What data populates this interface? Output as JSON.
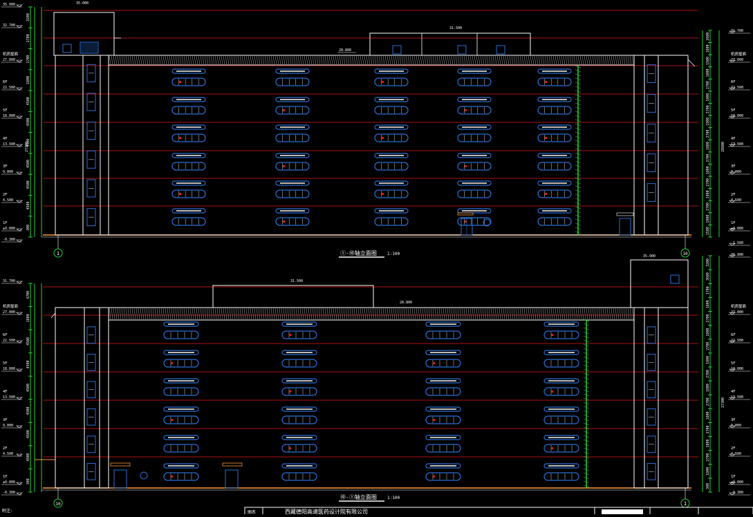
{
  "colors": {
    "background": "#000000",
    "outline": "#ffffff",
    "level_line": "#e81a1a",
    "dimension": "#29d23a",
    "window": "#2d6fd6",
    "facade": "#ff9a3c",
    "parapet_hatch": "#b0b0b0"
  },
  "top_elevation": {
    "title": "①-⑩轴立面图",
    "scale": "1:100",
    "axis_start": "1",
    "axis_end": "10",
    "tower_top_elev": "35.000",
    "roof_box_elev": "31.500",
    "parapet_elev": "28.800",
    "left_levels": [
      {
        "name": "",
        "elev": "35.900"
      },
      {
        "name": "",
        "elev": "32.700"
      },
      {
        "name": "机房屋面",
        "elev": "27.000"
      },
      {
        "name": "6F",
        "elev": "22.500"
      },
      {
        "name": "5F",
        "elev": "18.000"
      },
      {
        "name": "4F",
        "elev": "13.500"
      },
      {
        "name": "3F",
        "elev": "9.000"
      },
      {
        "name": "2F",
        "elev": "4.500"
      },
      {
        "name": "1F",
        "elev": "±0.000"
      },
      {
        "name": "",
        "elev": "-0.300"
      }
    ],
    "right_levels": [
      {
        "name": "",
        "elev": "31.700"
      },
      {
        "name": "机房屋面",
        "elev": "27.000"
      },
      {
        "name": "6F",
        "elev": "22.500"
      },
      {
        "name": "5F",
        "elev": "18.000"
      },
      {
        "name": "4F",
        "elev": "13.500"
      },
      {
        "name": "3F",
        "elev": "9.000"
      },
      {
        "name": "2F",
        "elev": "4.500"
      },
      {
        "name": "1F",
        "elev": "±0.000"
      },
      {
        "name": "",
        "elev": "-1.500"
      }
    ],
    "left_dims": [
      "3200",
      "2700",
      "1700",
      "1800",
      "4500",
      "4500",
      "4500",
      "4500",
      "4500",
      "4500",
      "300"
    ],
    "right_dims": [
      "2600",
      "1800",
      "1500",
      "1800",
      "2700",
      "1800",
      "2700",
      "1800",
      "2700",
      "1800",
      "2700",
      "1800",
      "2700",
      "1800",
      "2700",
      "1800",
      "1500"
    ],
    "right_total": "28800",
    "left_total": "27300"
  },
  "bottom_elevation": {
    "title": "⑩-①轴立面图",
    "scale": "1:100",
    "axis_start": "10",
    "axis_end": "1",
    "tower_top_elev": "35.900",
    "roof_box_elev": "31.500",
    "parapet_elev": "28.800",
    "left_levels": [
      {
        "name": "",
        "elev": "31.700"
      },
      {
        "name": "机房屋面",
        "elev": "27.000"
      },
      {
        "name": "6F",
        "elev": "22.500"
      },
      {
        "name": "5F",
        "elev": "18.000"
      },
      {
        "name": "4F",
        "elev": "13.500"
      },
      {
        "name": "3F",
        "elev": "9.000"
      },
      {
        "name": "2F",
        "elev": "4.500"
      },
      {
        "name": "1F",
        "elev": "±0.000"
      },
      {
        "name": "",
        "elev": "-0.300"
      }
    ],
    "right_levels": [
      {
        "name": "",
        "elev": "35.900"
      },
      {
        "name": "机房屋面",
        "elev": "27.000"
      },
      {
        "name": "6F",
        "elev": "22.500"
      },
      {
        "name": "5F",
        "elev": "18.000"
      },
      {
        "name": "4F",
        "elev": "13.500"
      },
      {
        "name": "3F",
        "elev": "9.000"
      },
      {
        "name": "2F",
        "elev": "4.500"
      },
      {
        "name": "1F",
        "elev": "±0.000"
      },
      {
        "name": "",
        "elev": "-0.300"
      }
    ],
    "left_dims": [
      "4700",
      "1800",
      "4500",
      "4500",
      "4500",
      "4500",
      "4500",
      "4500",
      "300"
    ],
    "right_dims": [
      "3200",
      "3600",
      "1700",
      "1800",
      "2700",
      "1800",
      "2700",
      "1800",
      "2700",
      "1800",
      "2700",
      "1800",
      "2700",
      "1800",
      "2700",
      "1800",
      "300"
    ],
    "right_total": "27300"
  },
  "title_block": {
    "label": "图名",
    "company": "西藏德阳高速医药设计院有限公司"
  },
  "notes_label": "附注:"
}
